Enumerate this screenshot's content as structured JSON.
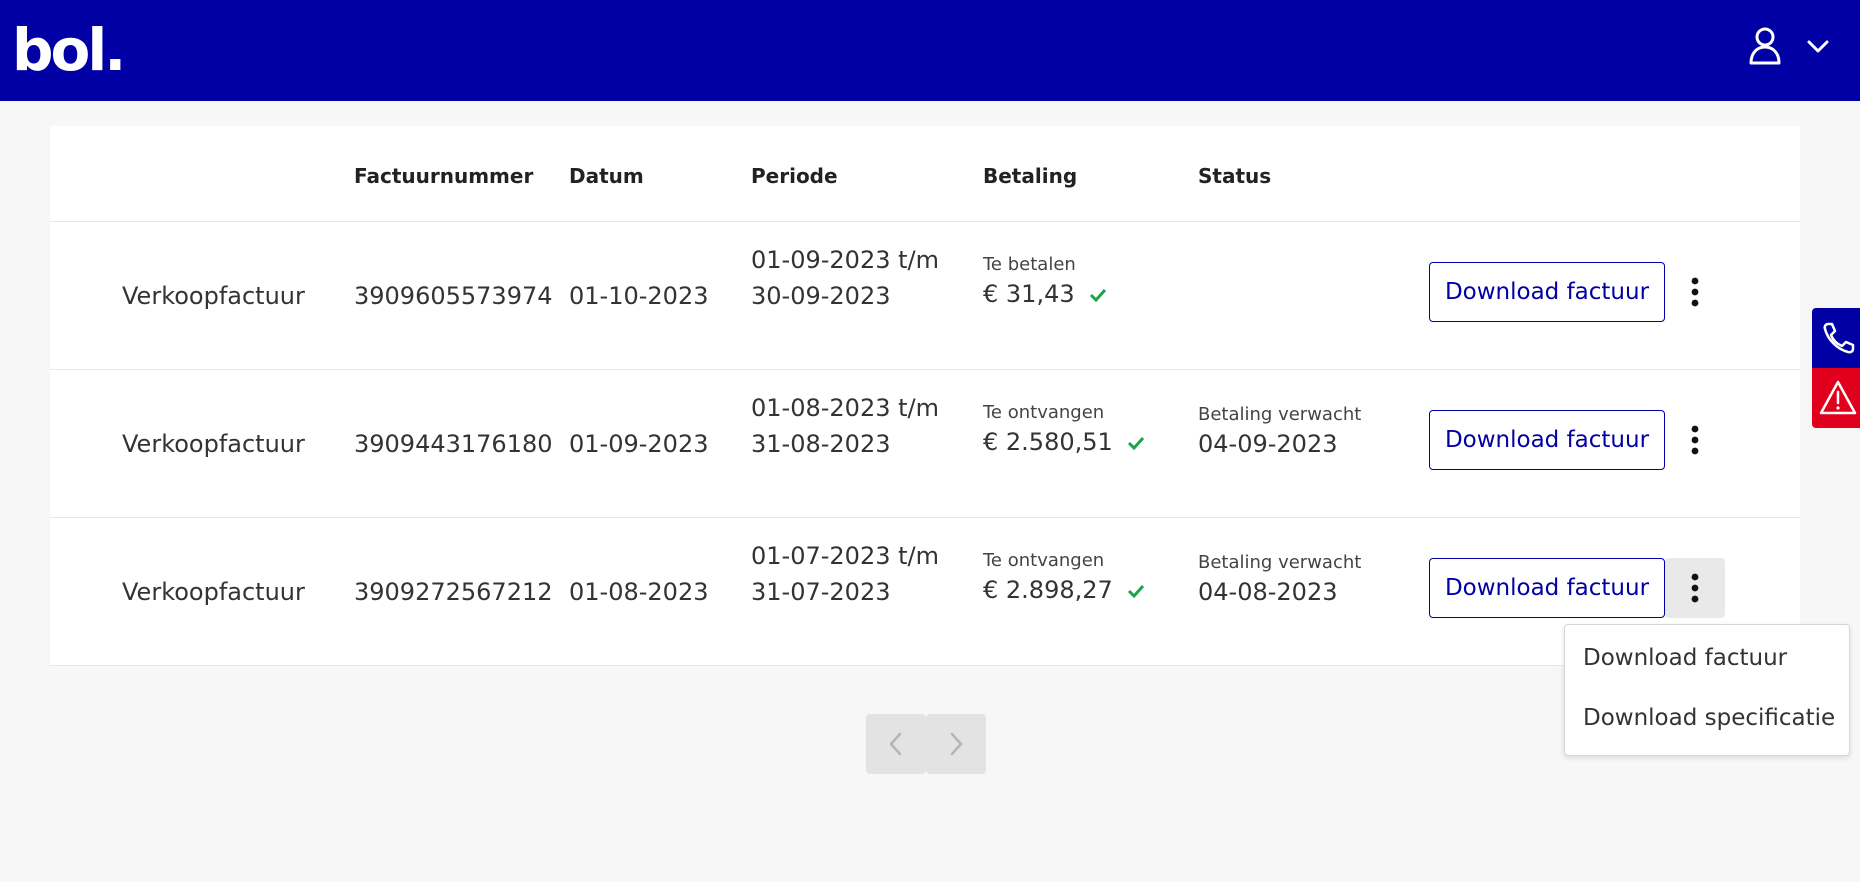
{
  "header": {
    "logo": "bol.",
    "brand_color": "#0000a4"
  },
  "table": {
    "columns": [
      "",
      "Factuurnummer",
      "Datum",
      "Periode",
      "Betaling",
      "Status"
    ],
    "rows": [
      {
        "type": "Verkoopfactuur",
        "number": "3909605573974",
        "date": "01-10-2023",
        "period_line1": "01-09-2023 t/m",
        "period_line2": "30-09-2023",
        "payment_label": "Te betalen",
        "payment_amount": "€ 31,43",
        "status_label": "",
        "status_date": "",
        "download_label": "Download factuur"
      },
      {
        "type": "Verkoopfactuur",
        "number": "3909443176180",
        "date": "01-09-2023",
        "period_line1": "01-08-2023 t/m",
        "period_line2": "31-08-2023",
        "payment_label": "Te ontvangen",
        "payment_amount": "€ 2.580,51",
        "status_label": "Betaling verwacht",
        "status_date": "04-09-2023",
        "download_label": "Download factuur"
      },
      {
        "type": "Verkoopfactuur",
        "number": "3909272567212",
        "date": "01-08-2023",
        "period_line1": "01-07-2023 t/m",
        "period_line2": "31-07-2023",
        "payment_label": "Te ontvangen",
        "payment_amount": "€ 2.898,27",
        "status_label": "Betaling verwacht",
        "status_date": "04-08-2023",
        "download_label": "Download factuur"
      }
    ]
  },
  "dropdown": {
    "items": [
      "Download factuur",
      "Download specificatie"
    ]
  },
  "colors": {
    "check": "#1aa648",
    "alert": "#e0001b"
  }
}
